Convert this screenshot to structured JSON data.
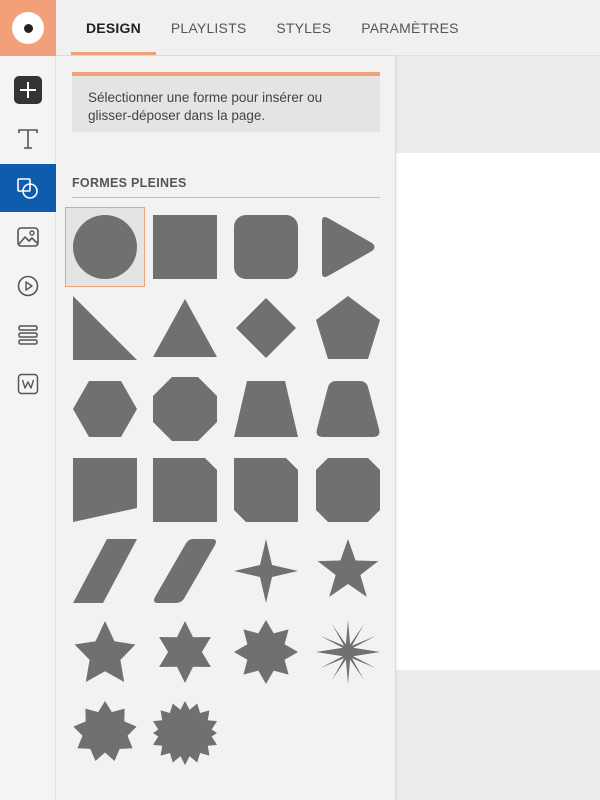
{
  "colors": {
    "accent": "#f2a079",
    "rail_active": "#0e5cad",
    "shape_fill": "#707070"
  },
  "logo": {
    "icon": "logo-icon"
  },
  "nav": {
    "tabs": [
      {
        "label": "DESIGN",
        "active": true
      },
      {
        "label": "PLAYLISTS",
        "active": false
      },
      {
        "label": "STYLES",
        "active": false
      },
      {
        "label": "PARAMÈTRES",
        "active": false
      }
    ]
  },
  "rail": {
    "items": [
      {
        "icon": "add-icon",
        "active": false
      },
      {
        "icon": "text-icon",
        "active": false
      },
      {
        "icon": "shapes-icon",
        "active": true
      },
      {
        "icon": "image-icon",
        "active": false
      },
      {
        "icon": "video-icon",
        "active": false
      },
      {
        "icon": "playlist-icon",
        "active": false
      },
      {
        "icon": "widget-icon",
        "active": false
      }
    ]
  },
  "panel": {
    "hint": "Sélectionner une forme pour insérer ou glisser-déposer dans la page.",
    "section_title": "FORMES PLEINES",
    "shapes": [
      "circle",
      "square",
      "rounded-square",
      "rounded-triangle",
      "right-triangle",
      "triangle",
      "diamond",
      "pentagon",
      "hexagon",
      "octagon",
      "trapezoid",
      "rounded-trapezoid",
      "slanted-quadrilateral",
      "snipped-corner-square",
      "snipped-corners-square",
      "all-corners-snipped-square",
      "parallelogram",
      "rounded-parallelogram",
      "four-point-star",
      "five-point-star",
      "six-point-star",
      "seven-point-star",
      "eight-point-star",
      "twelve-point-star",
      "ten-point-starburst",
      "sixteen-point-starburst"
    ],
    "selected_shape": "circle"
  }
}
